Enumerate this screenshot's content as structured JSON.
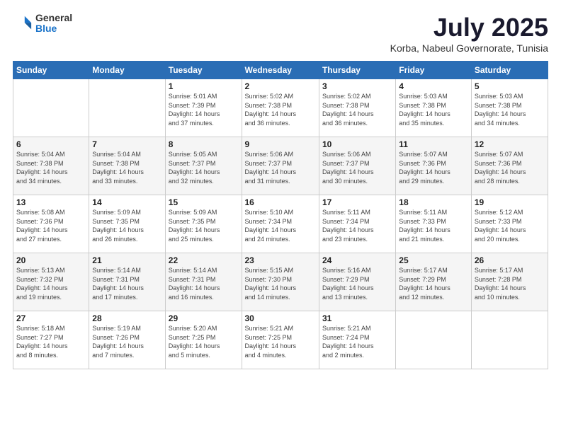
{
  "logo": {
    "general": "General",
    "blue": "Blue"
  },
  "title": {
    "month_year": "July 2025",
    "location": "Korba, Nabeul Governorate, Tunisia"
  },
  "calendar": {
    "headers": [
      "Sunday",
      "Monday",
      "Tuesday",
      "Wednesday",
      "Thursday",
      "Friday",
      "Saturday"
    ],
    "weeks": [
      [
        {
          "day": "",
          "info": ""
        },
        {
          "day": "",
          "info": ""
        },
        {
          "day": "1",
          "info": "Sunrise: 5:01 AM\nSunset: 7:39 PM\nDaylight: 14 hours\nand 37 minutes."
        },
        {
          "day": "2",
          "info": "Sunrise: 5:02 AM\nSunset: 7:38 PM\nDaylight: 14 hours\nand 36 minutes."
        },
        {
          "day": "3",
          "info": "Sunrise: 5:02 AM\nSunset: 7:38 PM\nDaylight: 14 hours\nand 36 minutes."
        },
        {
          "day": "4",
          "info": "Sunrise: 5:03 AM\nSunset: 7:38 PM\nDaylight: 14 hours\nand 35 minutes."
        },
        {
          "day": "5",
          "info": "Sunrise: 5:03 AM\nSunset: 7:38 PM\nDaylight: 14 hours\nand 34 minutes."
        }
      ],
      [
        {
          "day": "6",
          "info": "Sunrise: 5:04 AM\nSunset: 7:38 PM\nDaylight: 14 hours\nand 34 minutes."
        },
        {
          "day": "7",
          "info": "Sunrise: 5:04 AM\nSunset: 7:38 PM\nDaylight: 14 hours\nand 33 minutes."
        },
        {
          "day": "8",
          "info": "Sunrise: 5:05 AM\nSunset: 7:37 PM\nDaylight: 14 hours\nand 32 minutes."
        },
        {
          "day": "9",
          "info": "Sunrise: 5:06 AM\nSunset: 7:37 PM\nDaylight: 14 hours\nand 31 minutes."
        },
        {
          "day": "10",
          "info": "Sunrise: 5:06 AM\nSunset: 7:37 PM\nDaylight: 14 hours\nand 30 minutes."
        },
        {
          "day": "11",
          "info": "Sunrise: 5:07 AM\nSunset: 7:36 PM\nDaylight: 14 hours\nand 29 minutes."
        },
        {
          "day": "12",
          "info": "Sunrise: 5:07 AM\nSunset: 7:36 PM\nDaylight: 14 hours\nand 28 minutes."
        }
      ],
      [
        {
          "day": "13",
          "info": "Sunrise: 5:08 AM\nSunset: 7:36 PM\nDaylight: 14 hours\nand 27 minutes."
        },
        {
          "day": "14",
          "info": "Sunrise: 5:09 AM\nSunset: 7:35 PM\nDaylight: 14 hours\nand 26 minutes."
        },
        {
          "day": "15",
          "info": "Sunrise: 5:09 AM\nSunset: 7:35 PM\nDaylight: 14 hours\nand 25 minutes."
        },
        {
          "day": "16",
          "info": "Sunrise: 5:10 AM\nSunset: 7:34 PM\nDaylight: 14 hours\nand 24 minutes."
        },
        {
          "day": "17",
          "info": "Sunrise: 5:11 AM\nSunset: 7:34 PM\nDaylight: 14 hours\nand 23 minutes."
        },
        {
          "day": "18",
          "info": "Sunrise: 5:11 AM\nSunset: 7:33 PM\nDaylight: 14 hours\nand 21 minutes."
        },
        {
          "day": "19",
          "info": "Sunrise: 5:12 AM\nSunset: 7:33 PM\nDaylight: 14 hours\nand 20 minutes."
        }
      ],
      [
        {
          "day": "20",
          "info": "Sunrise: 5:13 AM\nSunset: 7:32 PM\nDaylight: 14 hours\nand 19 minutes."
        },
        {
          "day": "21",
          "info": "Sunrise: 5:14 AM\nSunset: 7:31 PM\nDaylight: 14 hours\nand 17 minutes."
        },
        {
          "day": "22",
          "info": "Sunrise: 5:14 AM\nSunset: 7:31 PM\nDaylight: 14 hours\nand 16 minutes."
        },
        {
          "day": "23",
          "info": "Sunrise: 5:15 AM\nSunset: 7:30 PM\nDaylight: 14 hours\nand 14 minutes."
        },
        {
          "day": "24",
          "info": "Sunrise: 5:16 AM\nSunset: 7:29 PM\nDaylight: 14 hours\nand 13 minutes."
        },
        {
          "day": "25",
          "info": "Sunrise: 5:17 AM\nSunset: 7:29 PM\nDaylight: 14 hours\nand 12 minutes."
        },
        {
          "day": "26",
          "info": "Sunrise: 5:17 AM\nSunset: 7:28 PM\nDaylight: 14 hours\nand 10 minutes."
        }
      ],
      [
        {
          "day": "27",
          "info": "Sunrise: 5:18 AM\nSunset: 7:27 PM\nDaylight: 14 hours\nand 8 minutes."
        },
        {
          "day": "28",
          "info": "Sunrise: 5:19 AM\nSunset: 7:26 PM\nDaylight: 14 hours\nand 7 minutes."
        },
        {
          "day": "29",
          "info": "Sunrise: 5:20 AM\nSunset: 7:25 PM\nDaylight: 14 hours\nand 5 minutes."
        },
        {
          "day": "30",
          "info": "Sunrise: 5:21 AM\nSunset: 7:25 PM\nDaylight: 14 hours\nand 4 minutes."
        },
        {
          "day": "31",
          "info": "Sunrise: 5:21 AM\nSunset: 7:24 PM\nDaylight: 14 hours\nand 2 minutes."
        },
        {
          "day": "",
          "info": ""
        },
        {
          "day": "",
          "info": ""
        }
      ]
    ]
  }
}
